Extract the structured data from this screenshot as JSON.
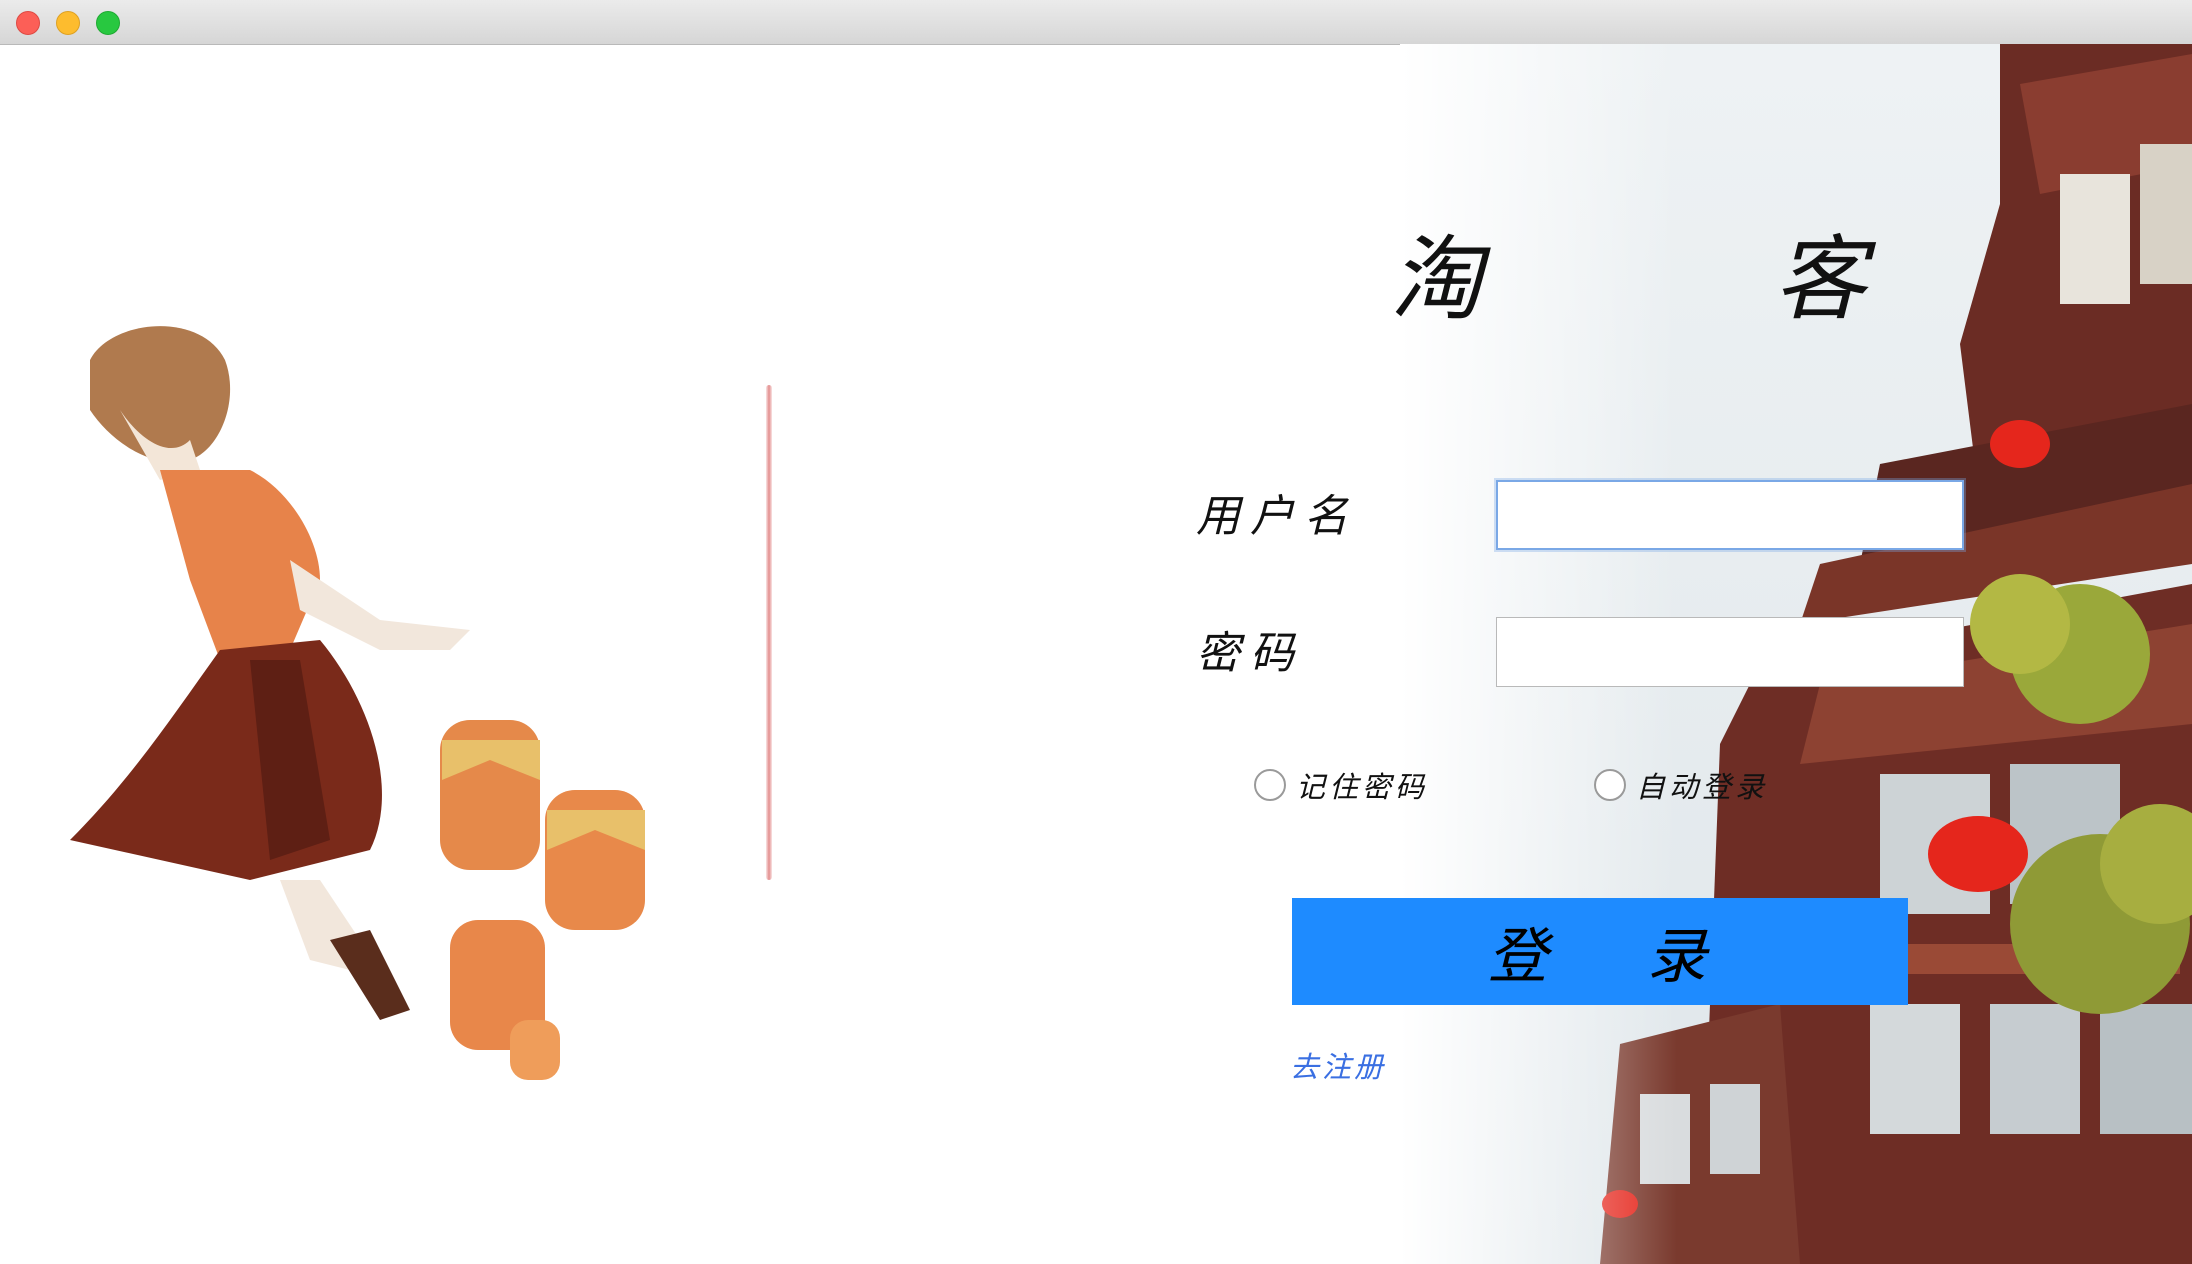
{
  "window": {
    "controls": [
      "close",
      "minimize",
      "maximize"
    ]
  },
  "app": {
    "title": "淘　客"
  },
  "form": {
    "username_label": "用户名",
    "username_value": "",
    "password_label": "密码",
    "password_value": "",
    "remember_label": "记住密码",
    "auto_login_label": "自动登录",
    "login_button": "登 录",
    "register_link": "去注册"
  },
  "colors": {
    "primary_button": "#1e8bff",
    "link": "#3a6fe2",
    "divider": "#e38d8d"
  },
  "icons": {
    "close": "close-icon",
    "minimize": "minimize-icon",
    "maximize": "maximize-icon"
  }
}
